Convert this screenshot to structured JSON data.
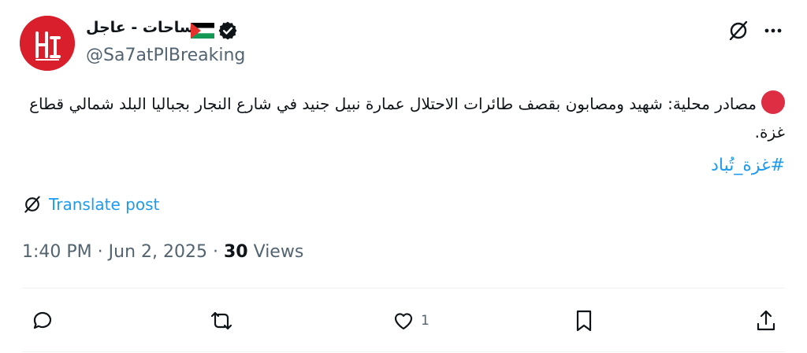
{
  "author": {
    "name": "ساحات - عاجل",
    "handle": "@Sa7atPlBreaking",
    "avatar_icon": "sa7at-logo",
    "flag_icon": "palestine-flag-icon",
    "verified_icon": "verified-badge-icon"
  },
  "post": {
    "text": "مصادر محلية: شهيد ومصابون بقصف طائرات الاحتلال عمارة نبيل جنيد في شارع النجار بجباليا البلد شمالي قطاع غزة.",
    "hashtag": "#غزة_تُباد",
    "translate_label": "Translate post"
  },
  "meta": {
    "time": "1:40 PM",
    "date": "Jun 2, 2025",
    "views_count": "30",
    "views_label": "Views"
  },
  "actions": {
    "reply_icon": "reply-icon",
    "repost_icon": "repost-icon",
    "like_icon": "heart-icon",
    "like_count": "1",
    "bookmark_icon": "bookmark-icon",
    "share_icon": "share-icon"
  },
  "colors": {
    "accent": "#1d9bf0",
    "avatar_red": "#d91f2b",
    "dot_red": "#dd2e44",
    "muted": "#536471"
  }
}
